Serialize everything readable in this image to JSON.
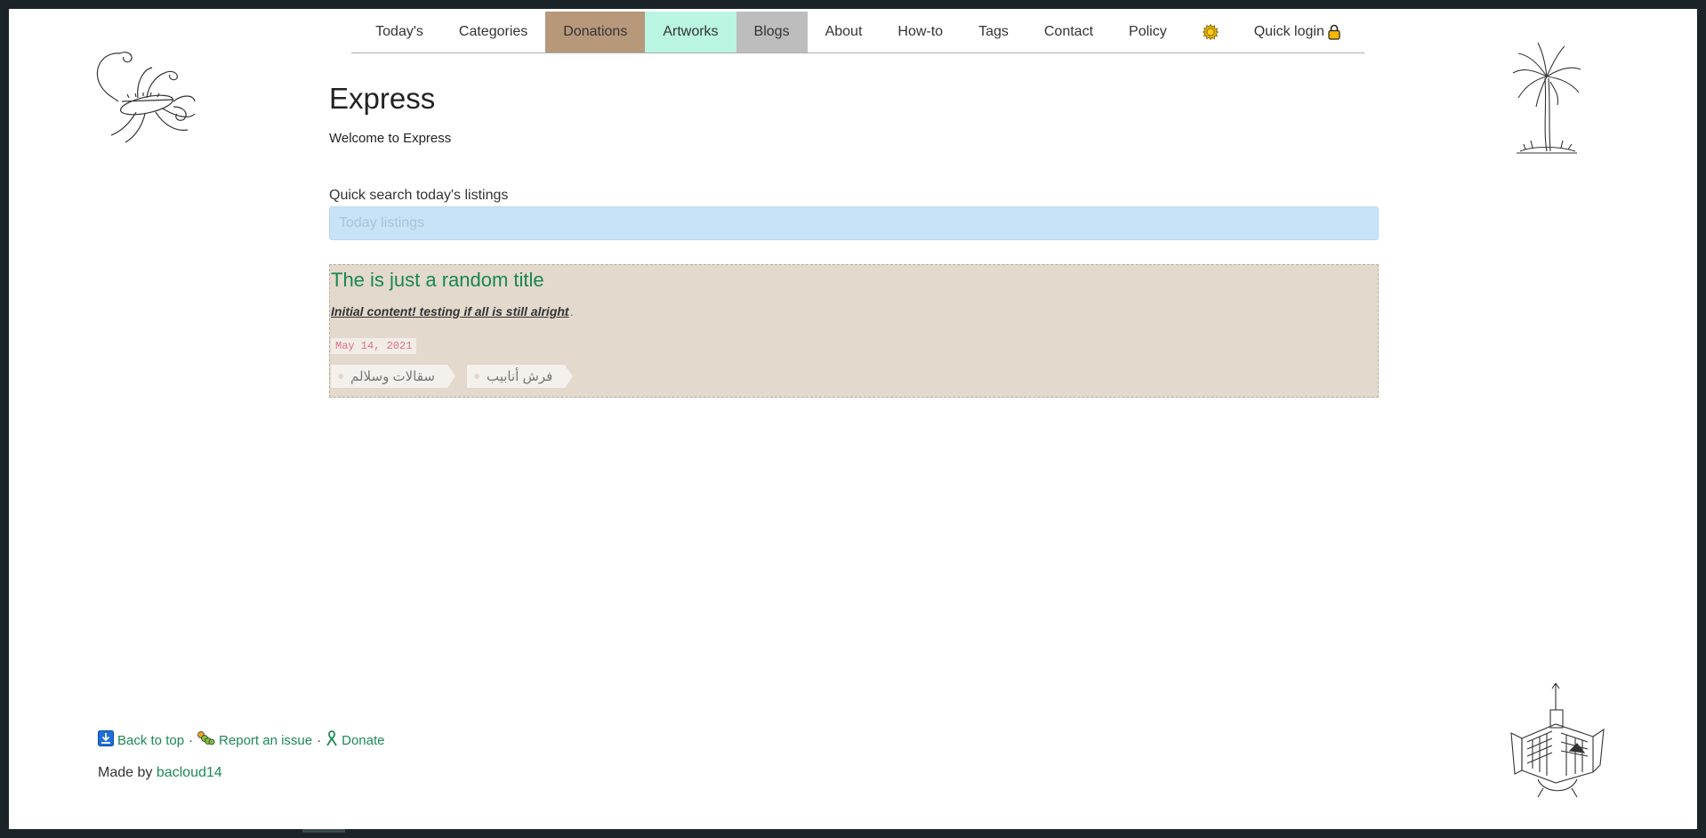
{
  "nav": {
    "items": [
      {
        "label": "Today's"
      },
      {
        "label": "Categories"
      },
      {
        "label": "Donations"
      },
      {
        "label": "Artworks"
      },
      {
        "label": "Blogs"
      },
      {
        "label": "About"
      },
      {
        "label": "How-to"
      },
      {
        "label": "Tags"
      },
      {
        "label": "Contact"
      },
      {
        "label": "Policy"
      }
    ],
    "theme_icon": "sun-icon",
    "login_label": "Quick login",
    "login_icon": "lock-icon"
  },
  "main": {
    "title": "Express",
    "welcome": "Welcome to Express",
    "search": {
      "label": "Quick search today's listings",
      "placeholder": "Today listings",
      "value": ""
    },
    "listing": {
      "title": "The is just a random title",
      "excerpt": "Initial content! testing if all is still alright ",
      "excerpt_ellipsis": "...",
      "date": "May 14, 2021",
      "tags": [
        "سقالات وسلالم",
        "فرش أنابيب"
      ]
    }
  },
  "footer": {
    "back_to_top": "Back to top",
    "report_issue": "Report an issue",
    "donate": "Donate",
    "separator": "·",
    "made_by_prefix": "Made by",
    "author": "bacloud14"
  },
  "colors": {
    "page_frame": "#1b2428",
    "link_green": "#1b8a54",
    "donations_bg": "#b7987a",
    "artworks_bg": "#b9f5e1",
    "blogs_bg": "#bdbdbd",
    "search_bg": "#c8e3f8",
    "card_bg": "#e3d9cc",
    "date_color": "#e0708a"
  }
}
